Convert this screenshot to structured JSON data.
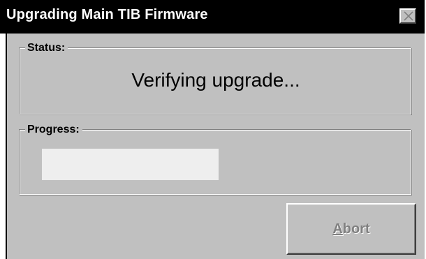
{
  "window": {
    "title": "Upgrading Main TIB Firmware",
    "close_icon": "close-icon"
  },
  "status_group": {
    "label": "Status:",
    "text": "Verifying upgrade..."
  },
  "progress_group": {
    "label": "Progress:",
    "value_fraction": 0
  },
  "buttons": {
    "abort_mnemonic": "A",
    "abort_rest": "bort",
    "abort_enabled": false
  },
  "colors": {
    "titlebar_bg": "#000000",
    "titlebar_text": "#ffffff",
    "face": "#c0c0c0",
    "progress_track": "#eeeeee",
    "disabled_text": "#808080"
  }
}
